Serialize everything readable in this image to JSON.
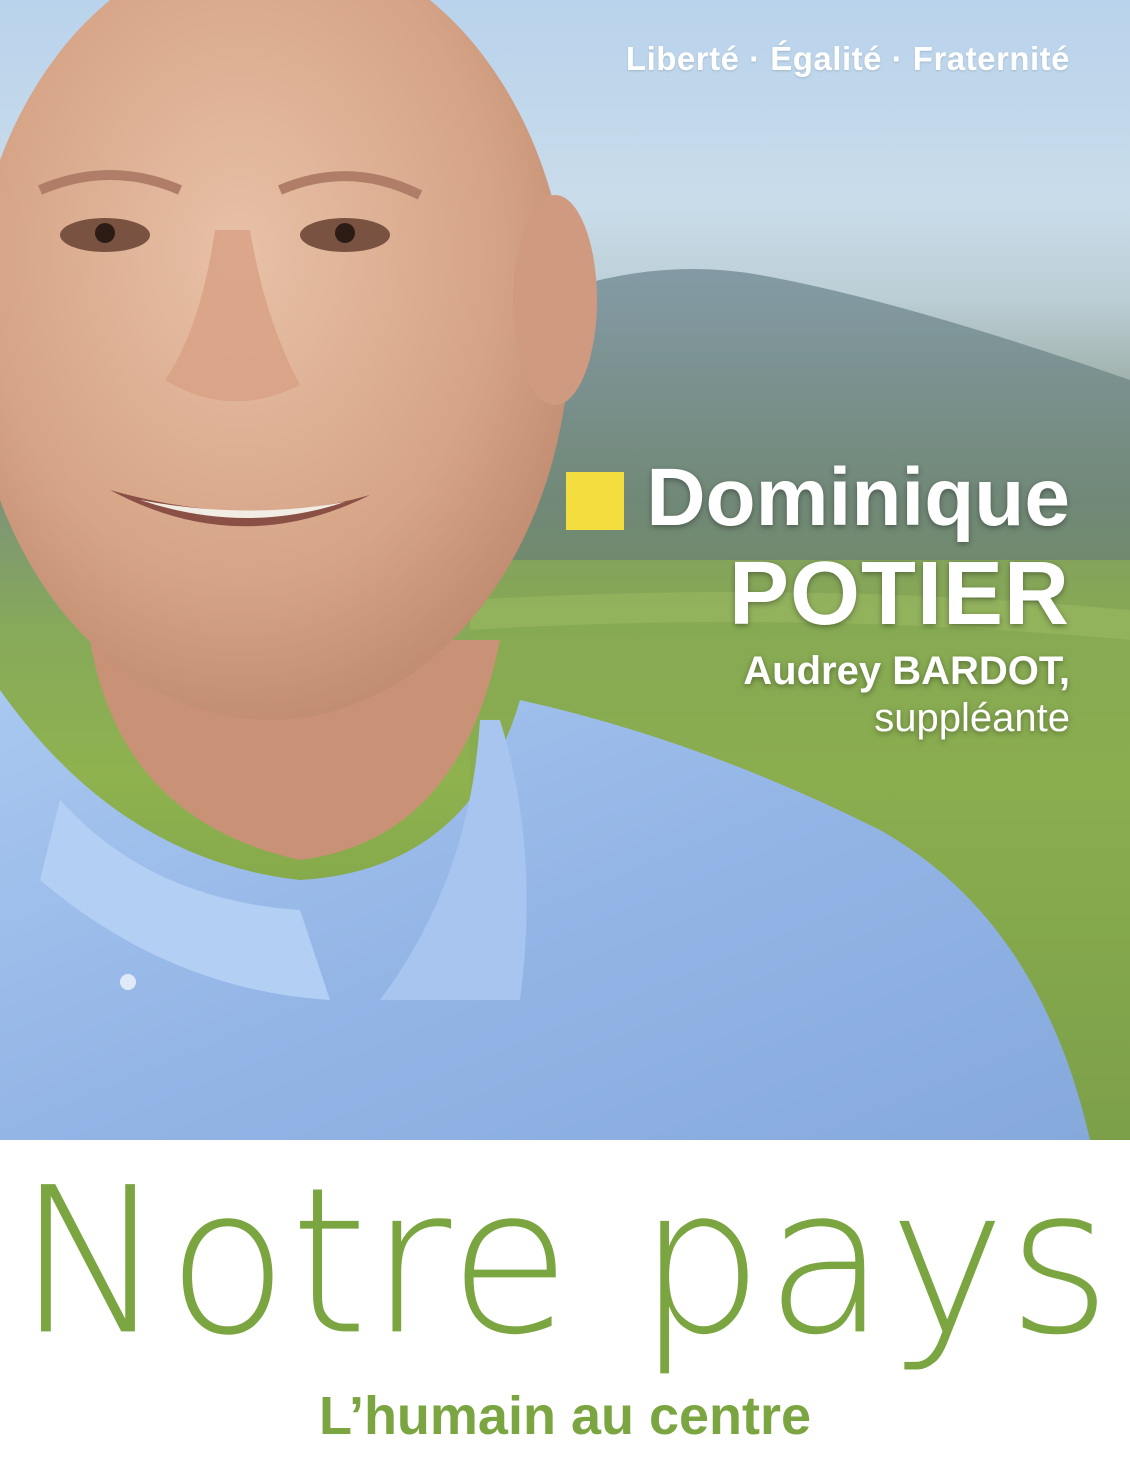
{
  "header": {
    "motto": "Liberté · Égalité · Fraternité"
  },
  "candidate": {
    "first_name": "Dominique",
    "last_name": "POTIER",
    "substitute_name": "Audrey BARDOT,",
    "substitute_role": "suppléante"
  },
  "slogan": {
    "title": "Notre pays",
    "subtitle": "L’humain au centre"
  },
  "colors": {
    "accent_green": "#7aa541",
    "square_yellow": "#f4de3f",
    "shirt_blue": "#9cbde9"
  },
  "photo": {
    "icon": "candidate-portrait"
  }
}
